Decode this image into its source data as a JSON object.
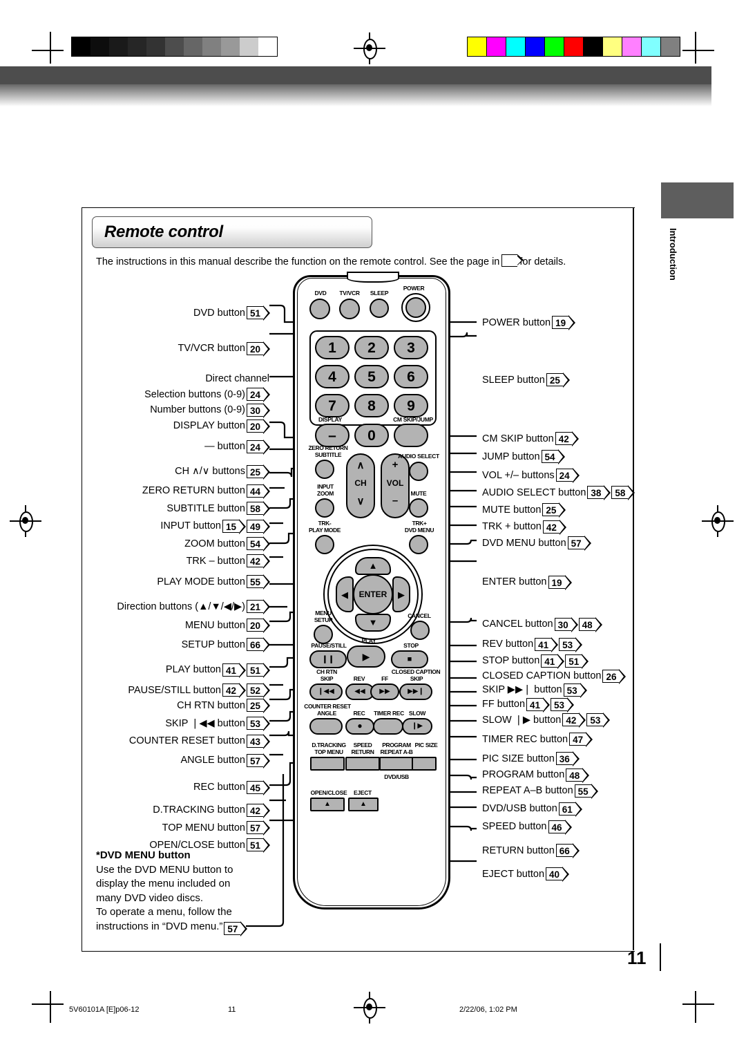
{
  "document": {
    "section_tab": "Introduction",
    "title": "Remote control",
    "intro_text_before": "The instructions in this manual describe the function on the remote control. See the page in",
    "intro_text_after": "for details.",
    "page_number": "11"
  },
  "footer": {
    "file_id": "5V60101A [E]p06-12",
    "page": "11",
    "timestamp": "2/22/06, 1:02 PM"
  },
  "note": {
    "heading": "*DVD MENU button",
    "lines": [
      "Use the DVD MENU button to",
      "display the menu included on",
      "many DVD video discs.",
      "To operate a menu, follow the",
      "instructions in “DVD menu.”"
    ],
    "ref": "57"
  },
  "left_callouts": [
    {
      "label": "DVD button",
      "refs": [
        "51"
      ]
    },
    {
      "label": "TV/VCR button",
      "refs": [
        "20"
      ]
    },
    {
      "label": "Direct channel",
      "refs": []
    },
    {
      "label": "Selection buttons (0-9)",
      "refs": [
        "24"
      ]
    },
    {
      "label": "Number buttons (0-9)",
      "refs": [
        "30"
      ]
    },
    {
      "label": "DISPLAY button",
      "refs": [
        "20"
      ]
    },
    {
      "label": "— button",
      "refs": [
        "24"
      ]
    },
    {
      "label": "CH ∧/∨ buttons",
      "refs": [
        "25"
      ]
    },
    {
      "label": "ZERO RETURN button",
      "refs": [
        "44"
      ]
    },
    {
      "label": "SUBTITLE button",
      "refs": [
        "58"
      ]
    },
    {
      "label": "INPUT button",
      "refs": [
        "15",
        "49"
      ]
    },
    {
      "label": "ZOOM button",
      "refs": [
        "54"
      ]
    },
    {
      "label": "TRK – button",
      "refs": [
        "42"
      ]
    },
    {
      "label": "PLAY MODE button",
      "refs": [
        "55"
      ]
    },
    {
      "label": "Direction buttons (▲/▼/◀/▶)",
      "refs": [
        "21"
      ]
    },
    {
      "label": "MENU button",
      "refs": [
        "20"
      ]
    },
    {
      "label": "SETUP button",
      "refs": [
        "66"
      ]
    },
    {
      "label": "PLAY button",
      "refs": [
        "41",
        "51"
      ]
    },
    {
      "label": "PAUSE/STILL button",
      "refs": [
        "42",
        "52"
      ]
    },
    {
      "label": "CH RTN button",
      "refs": [
        "25"
      ]
    },
    {
      "label": "SKIP ❘◀◀ button",
      "refs": [
        "53"
      ]
    },
    {
      "label": "COUNTER RESET button",
      "refs": [
        "43"
      ]
    },
    {
      "label": "ANGLE button",
      "refs": [
        "57"
      ]
    },
    {
      "label": "REC button",
      "refs": [
        "45"
      ]
    },
    {
      "label": "D.TRACKING button",
      "refs": [
        "42"
      ]
    },
    {
      "label": "TOP MENU button",
      "refs": [
        "57"
      ]
    },
    {
      "label": "OPEN/CLOSE button",
      "refs": [
        "51"
      ]
    }
  ],
  "right_callouts": [
    {
      "label": "POWER button",
      "refs": [
        "19"
      ]
    },
    {
      "label": "SLEEP button",
      "refs": [
        "25"
      ]
    },
    {
      "label": "CM SKIP button",
      "refs": [
        "42"
      ]
    },
    {
      "label": "JUMP button",
      "refs": [
        "54"
      ]
    },
    {
      "label": "VOL +/–  buttons",
      "refs": [
        "24"
      ]
    },
    {
      "label": "AUDIO SELECT button",
      "refs": [
        "38",
        "58"
      ]
    },
    {
      "label": "MUTE button",
      "refs": [
        "25"
      ]
    },
    {
      "label": "TRK + button",
      "refs": [
        "42"
      ]
    },
    {
      "label": "DVD MENU button",
      "refs": [
        "57"
      ]
    },
    {
      "label": "ENTER button",
      "refs": [
        "19"
      ]
    },
    {
      "label": "CANCEL button",
      "refs": [
        "30",
        "48"
      ]
    },
    {
      "label": "REV button",
      "refs": [
        "41",
        "53"
      ]
    },
    {
      "label": "STOP button",
      "refs": [
        "41",
        "51"
      ]
    },
    {
      "label": "CLOSED CAPTION button",
      "refs": [
        "26"
      ]
    },
    {
      "label": "SKIP ▶▶❘ button",
      "refs": [
        "53"
      ]
    },
    {
      "label": "FF button",
      "refs": [
        "41",
        "53"
      ]
    },
    {
      "label": "SLOW ❘▶ button",
      "refs": [
        "42",
        "53"
      ]
    },
    {
      "label": "TIMER REC button",
      "refs": [
        "47"
      ]
    },
    {
      "label": "PIC SIZE button",
      "refs": [
        "36"
      ]
    },
    {
      "label": "PROGRAM button",
      "refs": [
        "48"
      ]
    },
    {
      "label": "REPEAT A–B button",
      "refs": [
        "55"
      ]
    },
    {
      "label": "DVD/USB button",
      "refs": [
        "61"
      ]
    },
    {
      "label": "SPEED button",
      "refs": [
        "46"
      ]
    },
    {
      "label": "RETURN button",
      "refs": [
        "66"
      ]
    },
    {
      "label": "EJECT button",
      "refs": [
        "40"
      ]
    }
  ],
  "remote": {
    "top_row": [
      "DVD",
      "TV/VCR",
      "SLEEP",
      "POWER"
    ],
    "number_keys": [
      "1",
      "2",
      "3",
      "4",
      "5",
      "6",
      "7",
      "8",
      "9",
      "0"
    ],
    "display_caption": "DISPLAY",
    "cmskip_caption": "CM SKIP/JUMP",
    "zero_return": "ZERO RETURN",
    "subtitle": "SUBTITLE",
    "input": "INPUT",
    "zoom": "ZOOM",
    "trk_minus": "TRK-",
    "play_mode": "PLAY MODE",
    "ch_label": "CH",
    "vol_label": "VOL",
    "vol_plus": "+",
    "vol_minus": "–",
    "audio_select": "AUDIO SELECT",
    "mute": "MUTE",
    "trk_plus": "TRK+",
    "dvd_menu": "DVD MENU",
    "enter": "ENTER",
    "menu": "MENU",
    "setup": "SETUP",
    "cancel": "CANCEL",
    "pause_still": "PAUSE/STILL",
    "play": "PLAY",
    "stop": "STOP",
    "ch_rtn": "CH RTN",
    "skip_back": "SKIP",
    "rev": "REV",
    "ff": "FF",
    "closed_caption": "CLOSED CAPTION",
    "skip_fwd": "SKIP",
    "counter_reset": "COUNTER RESET",
    "angle": "ANGLE",
    "rec": "REC",
    "timer_rec": "TIMER REC",
    "slow": "SLOW",
    "d_tracking": "D.TRACKING",
    "top_menu": "TOP MENU",
    "speed": "SPEED",
    "return": "RETURN",
    "program": "PROGRAM",
    "repeat_ab": "REPEAT A-B",
    "pic_size": "PIC SIZE",
    "dvd_usb": "DVD/USB",
    "open_close": "OPEN/CLOSE",
    "eject": "EJECT",
    "glyphs": {
      "pause": "❙❙",
      "play": "▶",
      "stop": "■",
      "skip_back": "❘◀◀",
      "rev": "◀◀",
      "ff": "▶▶",
      "skip_fwd": "▶▶❘",
      "rec": "●",
      "slow": "❘▶",
      "eject": "▲",
      "ch_up": "∧",
      "ch_down": "∨",
      "dir_up": "▲",
      "dir_down": "▼",
      "dir_left": "◀",
      "dir_right": "▶"
    }
  },
  "colors": {
    "button_face": "#b3b3b3",
    "tab_grey": "#5e5e5e",
    "swatches": [
      "#ffff00",
      "#ff00ff",
      "#00ffff",
      "#0000ff",
      "#00ff00",
      "#ff0000",
      "#000000",
      "#ffff80",
      "#ff80ff",
      "#80ffff",
      "#808080"
    ],
    "grays": [
      "#000000",
      "#0d0d0d",
      "#1a1a1a",
      "#262626",
      "#333333",
      "#4d4d4d",
      "#666666",
      "#808080",
      "#999999",
      "#cccccc",
      "#ffffff"
    ]
  }
}
